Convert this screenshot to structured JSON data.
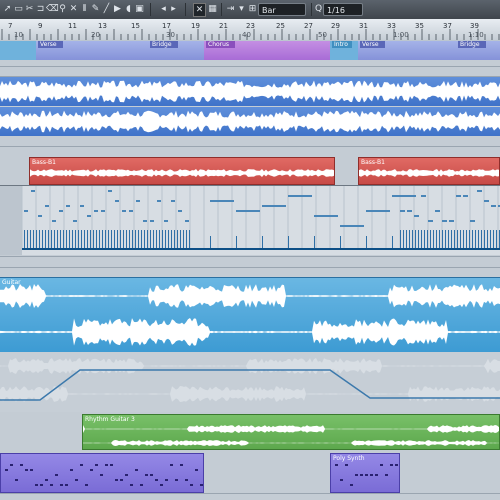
{
  "toolbar": {
    "tool_icons": [
      "object-select-icon",
      "range-select-icon",
      "split-icon",
      "glue-icon",
      "erase-icon",
      "zoom-icon",
      "mute-icon",
      "comp-icon",
      "draw-icon",
      "line-icon",
      "play-icon",
      "snap-icon"
    ],
    "snap_toggle_glyph": "✕",
    "grid_type": "Bar",
    "quantize": "1/16"
  },
  "ruler": {
    "bar_numbers_top": [
      "7",
      "9",
      "11",
      "13",
      "15",
      "17",
      "19",
      "21",
      "23",
      "25",
      "27",
      "29",
      "31",
      "33",
      "35",
      "37",
      "39"
    ],
    "bar_numbers_bottom": [
      "10",
      "20",
      "30",
      "40",
      "50",
      "1:00",
      "1:10"
    ]
  },
  "arranger": {
    "markers": [
      "Verse",
      "Bridge",
      "Chorus",
      "Intro",
      "Verse",
      "Bridge"
    ]
  },
  "clips": {
    "bass1": "Bass-B1",
    "bass2": "Bass-B1",
    "guitar": "Guitar",
    "rhythm_guitar": "Rhythm Guitar 3",
    "poly_synth": "Poly Synth"
  },
  "colors": {
    "audio_blue": "#3f73c9",
    "bass_red": "#c84a46",
    "guitar_cyan": "#3d9bd3",
    "rhythm_green": "#5da84d",
    "synth_purple": "#7a6cd6"
  }
}
